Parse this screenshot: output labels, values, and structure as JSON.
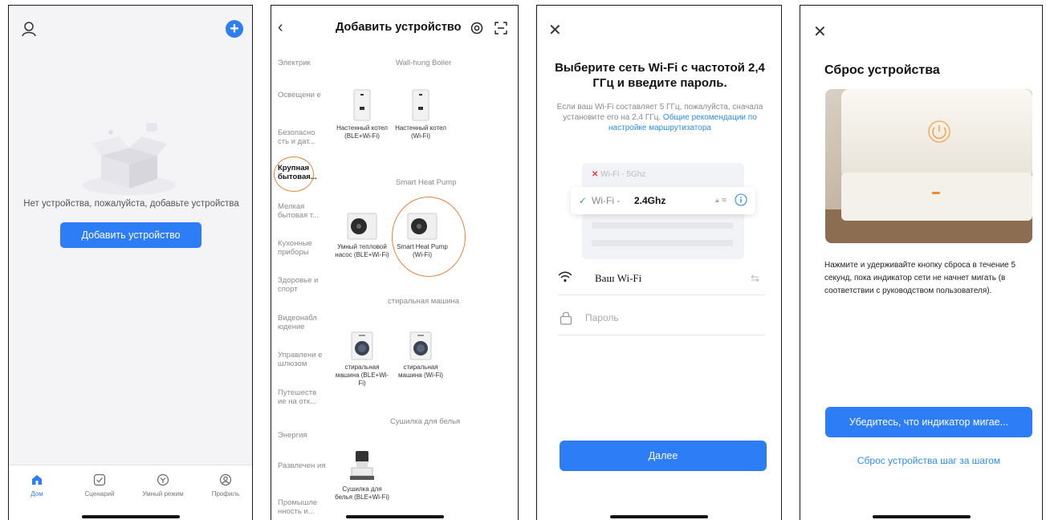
{
  "colors": {
    "accent": "#2d7df6",
    "highlight_circle": "#e5833a",
    "link": "#2d8cf0"
  },
  "screen1": {
    "empty_text": "Нет устройства, пожалуйста, добавьте устройства",
    "add_button": "Добавить устройство",
    "tabs": [
      {
        "label": "Дом",
        "icon": "home-icon"
      },
      {
        "label": "Сценарий",
        "icon": "checkbox-icon"
      },
      {
        "label": "Умный режим",
        "icon": "smart-mode-icon"
      },
      {
        "label": "Профиль",
        "icon": "profile-icon"
      }
    ]
  },
  "screen2": {
    "title": "Добавить устройство",
    "categories": [
      "Электрик",
      "Освещени е",
      "Безопасно сть и дат...",
      "Крупная бытовая...",
      "Мелкая бытовая т...",
      "Кухонные приборы",
      "Здоровье и спорт",
      "Видеонабл юдение",
      "Управлени е шлюзом",
      "Путешеств ие на отк...",
      "Энергия",
      "Развлечен ия",
      "Промышле нность и..."
    ],
    "sections": [
      "Wall-hung Boiler",
      "Smart Heat Pump",
      "стиральная машина",
      "Сушилка для белья"
    ],
    "devices": [
      "Настенный котел (BLE+Wi-Fi)",
      "Настенный котел (Wi-Fi)",
      "Умный тепловой насос (BLE+Wi-Fi)",
      "Smart Heat Pump (Wi-Fi)",
      "стиральная машина (BLE+Wi-Fi)",
      "стиральная машина (Wi-Fi)",
      "Сушилка для белья (BLE+Wi-Fi)"
    ]
  },
  "screen3": {
    "title": "Выберите сеть Wi-Fi с частотой 2,4 ГГц и введите пароль.",
    "desc_prefix": "Если ваш Wi-Fi составляет 5 ГГц, пожалуйста, сначала установите его на 2,4 ГГц.",
    "desc_link": "Общие рекомендации по настройке маршрутизатора",
    "wifi_5": "Wi-Fi - 5Ghz",
    "wifi_24_prefix": "Wi-Fi - ",
    "wifi_24_value": "2.4Ghz",
    "ssid_value": "Ваш Wi-Fi",
    "password_placeholder": "Пароль",
    "next_button": "Далее"
  },
  "screen4": {
    "title": "Сброс устройства",
    "desc": "Нажмите и удерживайте кнопку сброса в течение 5 секунд, пока индикатор сети не начнет мигать  (в соответствии с руководством пользователя).",
    "confirm_button": "Убедитесь, что индикатор мигае...",
    "step_link": "Сброс устройства шаг за шагом"
  }
}
